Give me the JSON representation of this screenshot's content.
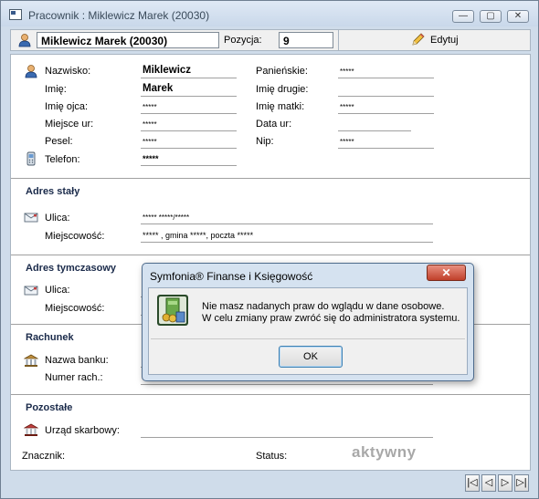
{
  "window": {
    "title": "Pracownik : Miklewicz Marek (20030)",
    "min_glyph": "—",
    "max_glyph": "▢",
    "close_glyph": "✕"
  },
  "toolbar": {
    "employee_name": "Miklewicz Marek (20030)",
    "position_label": "Pozycja:",
    "position_value": "9",
    "edit_label": "Edytuj"
  },
  "personal": {
    "nazwisko_label": "Nazwisko:",
    "nazwisko_value": "Miklewicz",
    "imie_label": "Imię:",
    "imie_value": "Marek",
    "imie_ojca_label": "Imię ojca:",
    "imie_ojca_value": "*****",
    "miejsce_ur_label": "Miejsce ur:",
    "miejsce_ur_value": "*****",
    "pesel_label": "Pesel:",
    "pesel_value": "*****",
    "telefon_label": "Telefon:",
    "telefon_value": "*****",
    "panienskie_label": "Panieńskie:",
    "panienskie_value": "*****",
    "imie_drugie_label": "Imię drugie:",
    "imie_drugie_value": "",
    "imie_matki_label": "Imię matki:",
    "imie_matki_value": "*****",
    "data_ur_label": "Data ur:",
    "data_ur_value": "",
    "nip_label": "Nip:",
    "nip_value": "*****"
  },
  "adres_staly": {
    "title": "Adres stały",
    "ulica_label": "Ulica:",
    "ulica_value": "***** *****/*****",
    "miejscowosc_label": "Miejscowość:",
    "miejscowosc_value": "***** , gmina *****, poczta *****"
  },
  "adres_tymczasowy": {
    "title": "Adres tymczasowy",
    "ulica_label": "Ulica:",
    "miejscowosc_label": "Miejscowość:"
  },
  "rachunek": {
    "title": "Rachunek",
    "bank_label": "Nazwa banku:",
    "numer_label": "Numer rach.:"
  },
  "pozostale": {
    "title": "Pozostałe",
    "urzad_label": "Urząd skarbowy:",
    "znacznik_label": "Znacznik:",
    "status_label": "Status:",
    "status_value": "aktywny"
  },
  "nav": {
    "first": "|◁",
    "prev": "◁",
    "next": "▷",
    "last": "▷|"
  },
  "dialog": {
    "title": "Symfonia® Finanse i Księgowość",
    "close_glyph": "✕",
    "message_line1": "Nie masz nadanych praw do wglądu w dane osobowe.",
    "message_line2": "W celu zmiany praw zwróć się do administratora systemu.",
    "ok_label": "OK"
  },
  "colors": {
    "status_text": "#a8a8a8",
    "close_button": "#c0402a",
    "window_frame": "#cfdcea"
  }
}
